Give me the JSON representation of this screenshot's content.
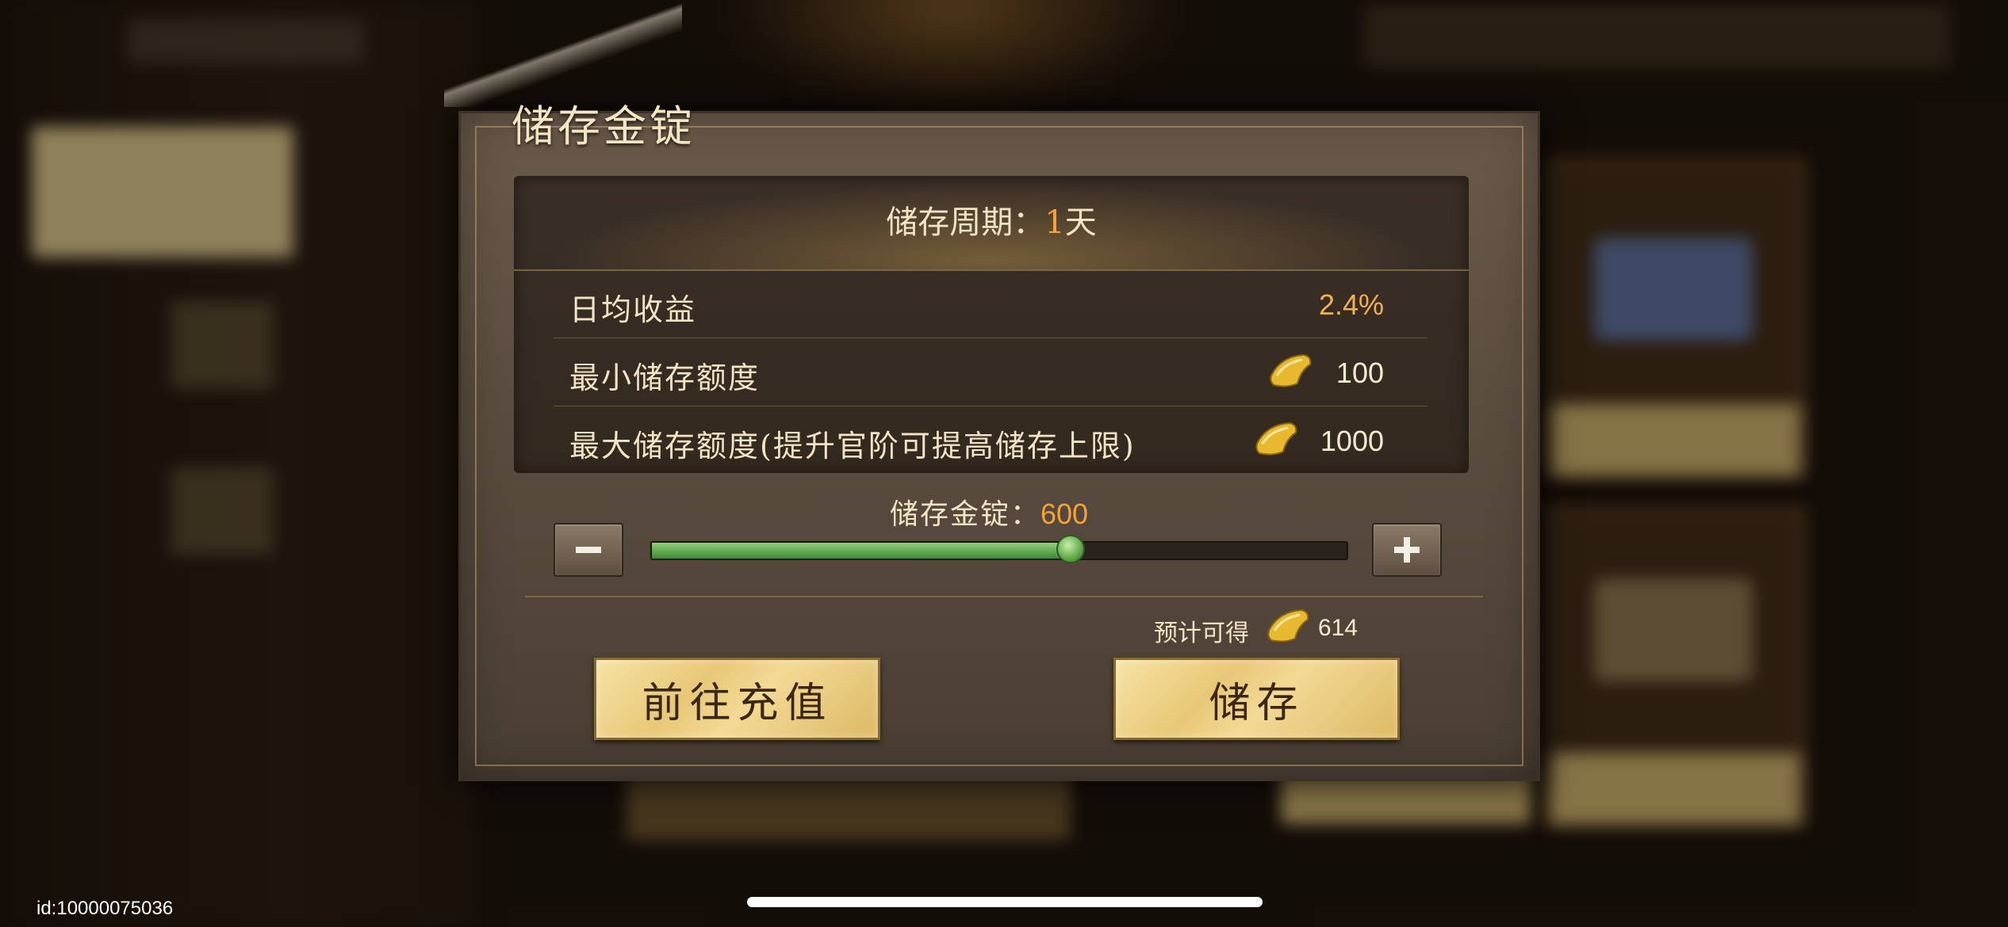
{
  "dialog": {
    "title": "储存金锭",
    "period_label": "储存周期：",
    "period_value": "1",
    "period_unit": "天",
    "rows": [
      {
        "label": "日均收益",
        "value": "2.4%"
      },
      {
        "label": "最小储存额度",
        "value": "100",
        "icon": "gold-ingot-icon"
      },
      {
        "label": "最大储存额度(提升官阶可提高储存上限)",
        "value": "1000",
        "icon": "gold-ingot-icon"
      }
    ],
    "slider": {
      "label": "储存金锭：",
      "value": "600",
      "min": 100,
      "max": 1000,
      "current": 600,
      "decrease_icon": "minus-icon",
      "increase_icon": "plus-icon"
    },
    "estimate_label": "预计可得",
    "estimate_value": "614",
    "buttons": {
      "recharge": "前往充值",
      "store": "储存"
    }
  },
  "footer": {
    "id_text": "id:10000075036"
  },
  "colors": {
    "accent": "#f3a33a",
    "button_gold": "#e8c877",
    "slider_green": "#4e9a3a"
  }
}
